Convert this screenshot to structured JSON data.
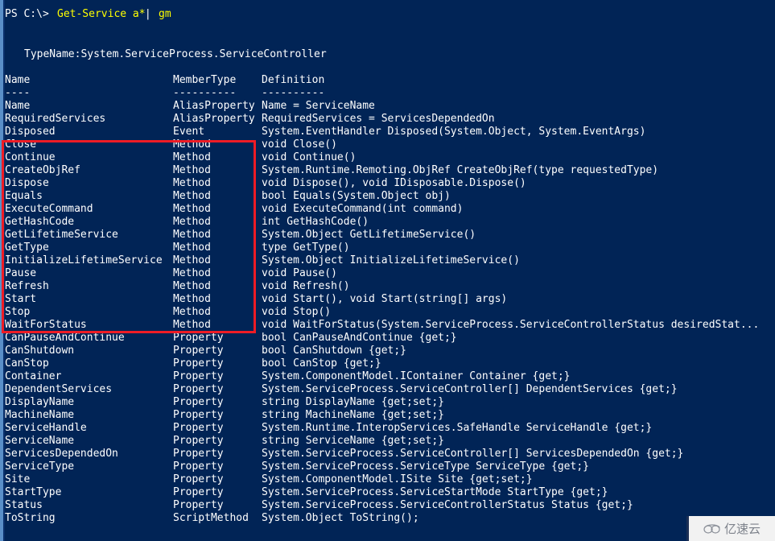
{
  "terminal": {
    "title": "Windows PowerShell",
    "background_color": "#012456",
    "foreground_color": "#ffffff",
    "command_color": "#ffff00",
    "highlight_color": "#ee1c25"
  },
  "prompt": {
    "prefix": "PS C:\\> ",
    "command": "Get-Service a*",
    "pipe": " | ",
    "command2": "gm"
  },
  "output": {
    "typename_line": "TypeName:System.ServiceProcess.ServiceController",
    "headers": {
      "name": "Name",
      "membertype": "MemberType",
      "definition": "Definition"
    },
    "rules": {
      "name": "----",
      "membertype": "----------",
      "definition": "----------"
    },
    "rows": [
      {
        "name": "Name",
        "membertype": "AliasProperty",
        "definition": "Name = ServiceName"
      },
      {
        "name": "RequiredServices",
        "membertype": "AliasProperty",
        "definition": "RequiredServices = ServicesDependedOn"
      },
      {
        "name": "Disposed",
        "membertype": "Event",
        "definition": "System.EventHandler Disposed(System.Object, System.EventArgs)"
      },
      {
        "name": "Close",
        "membertype": "Method",
        "definition": "void Close()"
      },
      {
        "name": "Continue",
        "membertype": "Method",
        "definition": "void Continue()"
      },
      {
        "name": "CreateObjRef",
        "membertype": "Method",
        "definition": "System.Runtime.Remoting.ObjRef CreateObjRef(type requestedType)"
      },
      {
        "name": "Dispose",
        "membertype": "Method",
        "definition": "void Dispose(), void IDisposable.Dispose()"
      },
      {
        "name": "Equals",
        "membertype": "Method",
        "definition": "bool Equals(System.Object obj)"
      },
      {
        "name": "ExecuteCommand",
        "membertype": "Method",
        "definition": "void ExecuteCommand(int command)"
      },
      {
        "name": "GetHashCode",
        "membertype": "Method",
        "definition": "int GetHashCode()"
      },
      {
        "name": "GetLifetimeService",
        "membertype": "Method",
        "definition": "System.Object GetLifetimeService()"
      },
      {
        "name": "GetType",
        "membertype": "Method",
        "definition": "type GetType()"
      },
      {
        "name": "InitializeLifetimeService",
        "membertype": "Method",
        "definition": "System.Object InitializeLifetimeService()"
      },
      {
        "name": "Pause",
        "membertype": "Method",
        "definition": "void Pause()"
      },
      {
        "name": "Refresh",
        "membertype": "Method",
        "definition": "void Refresh()"
      },
      {
        "name": "Start",
        "membertype": "Method",
        "definition": "void Start(), void Start(string[] args)"
      },
      {
        "name": "Stop",
        "membertype": "Method",
        "definition": "void Stop()"
      },
      {
        "name": "WaitForStatus",
        "membertype": "Method",
        "definition": "void WaitForStatus(System.ServiceProcess.ServiceControllerStatus desiredStat..."
      },
      {
        "name": "CanPauseAndContinue",
        "membertype": "Property",
        "definition": "bool CanPauseAndContinue {get;}"
      },
      {
        "name": "CanShutdown",
        "membertype": "Property",
        "definition": "bool CanShutdown {get;}"
      },
      {
        "name": "CanStop",
        "membertype": "Property",
        "definition": "bool CanStop {get;}"
      },
      {
        "name": "Container",
        "membertype": "Property",
        "definition": "System.ComponentModel.IContainer Container {get;}"
      },
      {
        "name": "DependentServices",
        "membertype": "Property",
        "definition": "System.ServiceProcess.ServiceController[] DependentServices {get;}"
      },
      {
        "name": "DisplayName",
        "membertype": "Property",
        "definition": "string DisplayName {get;set;}"
      },
      {
        "name": "MachineName",
        "membertype": "Property",
        "definition": "string MachineName {get;set;}"
      },
      {
        "name": "ServiceHandle",
        "membertype": "Property",
        "definition": "System.Runtime.InteropServices.SafeHandle ServiceHandle {get;}"
      },
      {
        "name": "ServiceName",
        "membertype": "Property",
        "definition": "string ServiceName {get;set;}"
      },
      {
        "name": "ServicesDependedOn",
        "membertype": "Property",
        "definition": "System.ServiceProcess.ServiceController[] ServicesDependedOn {get;}"
      },
      {
        "name": "ServiceType",
        "membertype": "Property",
        "definition": "System.ServiceProcess.ServiceType ServiceType {get;}"
      },
      {
        "name": "Site",
        "membertype": "Property",
        "definition": "System.ComponentModel.ISite Site {get;set;}"
      },
      {
        "name": "StartType",
        "membertype": "Property",
        "definition": "System.ServiceProcess.ServiceStartMode StartType {get;}"
      },
      {
        "name": "Status",
        "membertype": "Property",
        "definition": "System.ServiceProcess.ServiceControllerStatus Status {get;}"
      },
      {
        "name": "ToString",
        "membertype": "ScriptMethod",
        "definition": "System.Object ToString();"
      }
    ]
  },
  "annotation": {
    "highlight_label": "methods-highlight-rectangle"
  },
  "watermark": {
    "text": "亿速云",
    "icon": "cloud-icon"
  }
}
